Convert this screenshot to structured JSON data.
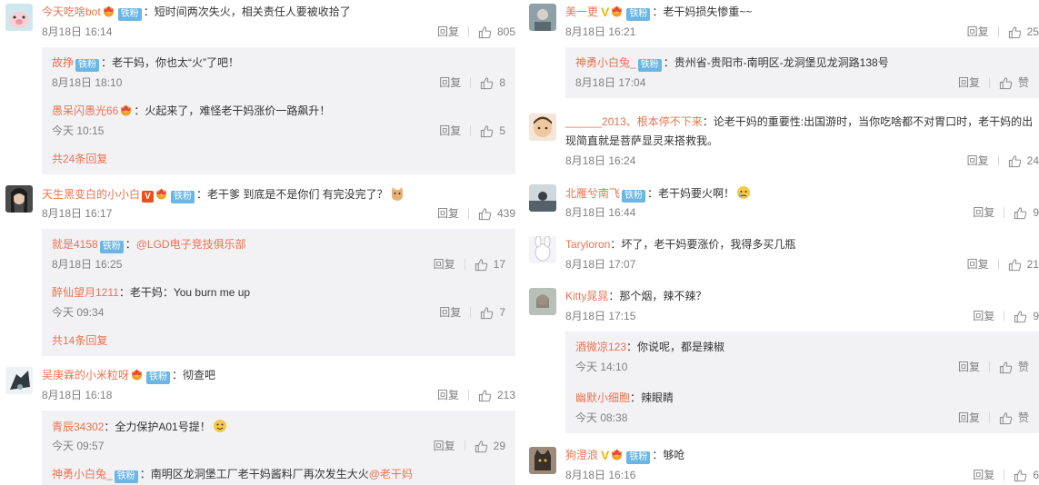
{
  "ui": {
    "reply": "回复",
    "like_placeholder": "赞"
  },
  "colors": {
    "name": "#eb7350",
    "badge": "#6ab6e4",
    "meta": "#808080",
    "reply_box": "#f2f2f5"
  },
  "left": {
    "c1": {
      "user": "今天吃啥bot",
      "badge": "铁粉",
      "text": "：短时间两次失火，相关责任人要被收拾了",
      "time": "8月18日 16:14",
      "likes": "805",
      "replies": [
        {
          "user": "故挣",
          "badge": "铁粉",
          "text": "：老干妈，你也太“火”了吧！",
          "time": "8月18日 18:10",
          "likes": "8"
        },
        {
          "user": "愚呆闪愚光66",
          "text": "：火起来了，难怪老干妈涨价一路飙升！",
          "time": "今天 10:15",
          "likes": "5"
        }
      ],
      "more": "共24条回复"
    },
    "c2": {
      "user": "天生黑变白的小小白",
      "badge": "铁粉",
      "text": "：老干爹 到底是不是你们 有完没完了？",
      "time": "8月18日 16:17",
      "likes": "439",
      "replies": [
        {
          "user": "就是4158",
          "badge": "铁粉",
          "text": "：",
          "mention": "@LGD电子竞技俱乐部",
          "time": "8月18日 16:25",
          "likes": "17"
        },
        {
          "user": "醉仙望月1211",
          "text": "：老干妈：You burn me up",
          "time": "今天 09:34",
          "likes": "7"
        }
      ],
      "more": "共14条回复"
    },
    "c3": {
      "user": "吴庚霖的小米粒呀",
      "badge": "铁粉",
      "text": "：彻查吧",
      "time": "8月18日 16:18",
      "likes": "213",
      "replies": [
        {
          "user": "青辰34302",
          "text": "：全力保护A01号提！",
          "time": "今天 09:57",
          "likes": "29"
        },
        {
          "user": "神勇小白兔_",
          "badge": "铁粉",
          "text": "：南明区龙洞堡工厂老干妈酱料厂再次发生大火",
          "mention": "@老干妈"
        }
      ]
    }
  },
  "right": {
    "c1": {
      "user": "美一更",
      "badge": "铁粉",
      "text": "：老干妈损失惨重~~",
      "time": "8月18日 16:21",
      "likes": "25",
      "replies": [
        {
          "user": "神勇小白兔_",
          "badge": "铁粉",
          "text": "：贵州省-贵阳市-南明区-龙洞堡见龙洞路138号",
          "time": "8月18日 17:04",
          "likes": "赞"
        }
      ]
    },
    "c2": {
      "user": "______2013、根本停不下来",
      "text": "：论老干妈的重要性:出国游时，当你吃啥都不对胃口时，老干妈的出",
      "text2": "现简直就是菩萨显灵来搭救我。",
      "time": "8月18日 16:24",
      "likes": "24"
    },
    "c3": {
      "user": "北雁兮南飞",
      "badge": "铁粉",
      "text": "：老干妈要火啊！",
      "time": "8月18日 16:44",
      "likes": "9"
    },
    "c4": {
      "user": "Taryloron",
      "text": "：坏了，老干妈要涨价，我得多买几瓶",
      "time": "8月18日 17:07",
      "likes": "21"
    },
    "c5": {
      "user": "Kitty晁晁",
      "text": "：那个烟，辣不辣？",
      "time": "8月18日 17:15",
      "likes": "9",
      "replies": [
        {
          "user": "酒微凉123",
          "text": "：你说呢，都是辣椒",
          "time": "今天 14:10",
          "likes": "赞"
        },
        {
          "user": "幽默小细胞",
          "text": "：辣眼睛",
          "time": "今天 08:38",
          "likes": "赞"
        }
      ]
    },
    "c6": {
      "user": "狗澄浪",
      "badge": "铁粉",
      "text": "：够呛",
      "time": "8月18日 16:16",
      "likes": "6"
    }
  }
}
